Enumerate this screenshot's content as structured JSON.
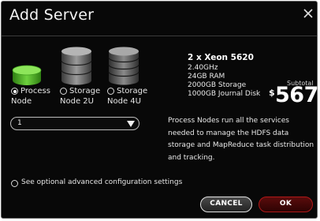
{
  "dialog": {
    "title": "Add Server"
  },
  "node_types": [
    {
      "label_line1": "Process",
      "label_line2": "Node",
      "selected": true,
      "icon": "green-database-icon"
    },
    {
      "label_line1": "Storage",
      "label_line2": "Node 2U",
      "selected": false,
      "icon": "gray-database-icon"
    },
    {
      "label_line1": "Storage",
      "label_line2": "Node 4U",
      "selected": false,
      "icon": "gray-database-tall-icon"
    }
  ],
  "specs": {
    "cpu": "2 x Xeon 5620",
    "speed": "2.40GHz",
    "ram": "24GB RAM",
    "storage": "2000GB Storage",
    "journal": "1000GB Journal Disk"
  },
  "subtotal": {
    "label": "Subtotal",
    "currency": "$",
    "amount": "567"
  },
  "quantity": {
    "value": "1"
  },
  "description": "Process Nodes run all the services needed to manage the HDFS data storage and MapReduce task distribution and tracking.",
  "advanced": {
    "label": "See optional advanced configuration settings",
    "selected": false
  },
  "buttons": {
    "cancel": "CANCEL",
    "ok": "OK"
  },
  "colors": {
    "background": "#080808",
    "accent_green": "#4caf2a",
    "ok_border": "#b01818"
  }
}
